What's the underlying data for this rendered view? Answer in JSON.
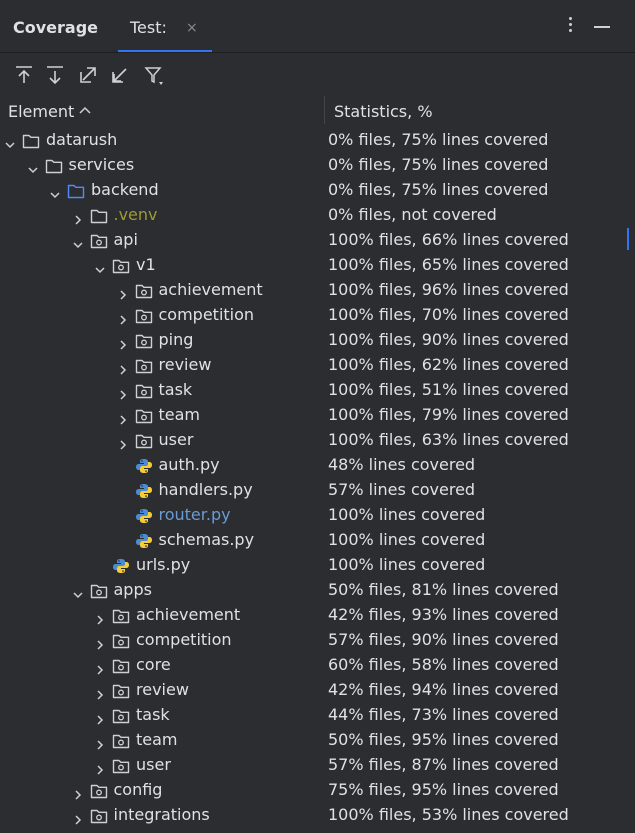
{
  "panel": {
    "title": "Coverage",
    "tab_label": "Test:",
    "tab_close": "×"
  },
  "toolbar": {
    "buttons": [
      "navigate-up-icon",
      "navigate-down-icon",
      "expand-icon",
      "collapse-icon",
      "filter-icon"
    ]
  },
  "columns": {
    "element": "Element",
    "statistics": "Statistics, %"
  },
  "colors": {
    "accent": "#3574f0",
    "excluded": "#9e9a33",
    "modified_file": "#6c9bd3",
    "text": "#dfe1e5"
  },
  "rows": [
    {
      "level": 0,
      "expanded": true,
      "icon": "folder-icon",
      "name": "datarush",
      "stat": "0% files, 75% lines covered"
    },
    {
      "level": 1,
      "expanded": true,
      "icon": "folder-icon",
      "name": "services",
      "stat": "0% files, 75% lines covered"
    },
    {
      "level": 2,
      "expanded": true,
      "icon": "source-folder-icon",
      "name": "backend",
      "stat": "0% files, 75% lines covered"
    },
    {
      "level": 3,
      "expanded": false,
      "icon": "excluded-folder-icon",
      "name": ".venv",
      "stat": "0% files, not covered",
      "style": "excluded"
    },
    {
      "level": 3,
      "expanded": true,
      "icon": "package-icon",
      "name": "api",
      "stat": "100% files, 66% lines covered"
    },
    {
      "level": 4,
      "expanded": true,
      "icon": "package-icon",
      "name": "v1",
      "stat": "100% files, 65% lines covered"
    },
    {
      "level": 5,
      "expanded": false,
      "icon": "package-icon",
      "name": "achievement",
      "stat": "100% files, 96% lines covered"
    },
    {
      "level": 5,
      "expanded": false,
      "icon": "package-icon",
      "name": "competition",
      "stat": "100% files, 70% lines covered"
    },
    {
      "level": 5,
      "expanded": false,
      "icon": "package-icon",
      "name": "ping",
      "stat": "100% files, 90% lines covered"
    },
    {
      "level": 5,
      "expanded": false,
      "icon": "package-icon",
      "name": "review",
      "stat": "100% files, 62% lines covered"
    },
    {
      "level": 5,
      "expanded": false,
      "icon": "package-icon",
      "name": "task",
      "stat": "100% files, 51% lines covered"
    },
    {
      "level": 5,
      "expanded": false,
      "icon": "package-icon",
      "name": "team",
      "stat": "100% files, 79% lines covered"
    },
    {
      "level": 5,
      "expanded": false,
      "icon": "package-icon",
      "name": "user",
      "stat": "100% files, 63% lines covered"
    },
    {
      "level": 5,
      "leaf": true,
      "icon": "python-file-icon",
      "name": "auth.py",
      "stat": "48% lines covered"
    },
    {
      "level": 5,
      "leaf": true,
      "icon": "python-file-icon",
      "name": "handlers.py",
      "stat": "57% lines covered"
    },
    {
      "level": 5,
      "leaf": true,
      "icon": "python-file-icon",
      "name": "router.py",
      "stat": "100% lines covered",
      "style": "modified"
    },
    {
      "level": 5,
      "leaf": true,
      "icon": "python-file-icon",
      "name": "schemas.py",
      "stat": "100% lines covered"
    },
    {
      "level": 4,
      "leaf": true,
      "icon": "python-file-icon",
      "name": "urls.py",
      "stat": "100% lines covered"
    },
    {
      "level": 3,
      "expanded": true,
      "icon": "package-icon",
      "name": "apps",
      "stat": "50% files, 81% lines covered"
    },
    {
      "level": 4,
      "expanded": false,
      "icon": "package-icon",
      "name": "achievement",
      "stat": "42% files, 93% lines covered"
    },
    {
      "level": 4,
      "expanded": false,
      "icon": "package-icon",
      "name": "competition",
      "stat": "57% files, 90% lines covered"
    },
    {
      "level": 4,
      "expanded": false,
      "icon": "package-icon",
      "name": "core",
      "stat": "60% files, 58% lines covered"
    },
    {
      "level": 4,
      "expanded": false,
      "icon": "package-icon",
      "name": "review",
      "stat": "42% files, 94% lines covered"
    },
    {
      "level": 4,
      "expanded": false,
      "icon": "package-icon",
      "name": "task",
      "stat": "44% files, 73% lines covered"
    },
    {
      "level": 4,
      "expanded": false,
      "icon": "package-icon",
      "name": "team",
      "stat": "50% files, 95% lines covered"
    },
    {
      "level": 4,
      "expanded": false,
      "icon": "package-icon",
      "name": "user",
      "stat": "57% files, 87% lines covered"
    },
    {
      "level": 3,
      "expanded": false,
      "icon": "package-icon",
      "name": "config",
      "stat": "75% files, 95% lines covered"
    },
    {
      "level": 3,
      "expanded": false,
      "icon": "package-icon",
      "name": "integrations",
      "stat": "100% files, 53% lines covered"
    }
  ]
}
